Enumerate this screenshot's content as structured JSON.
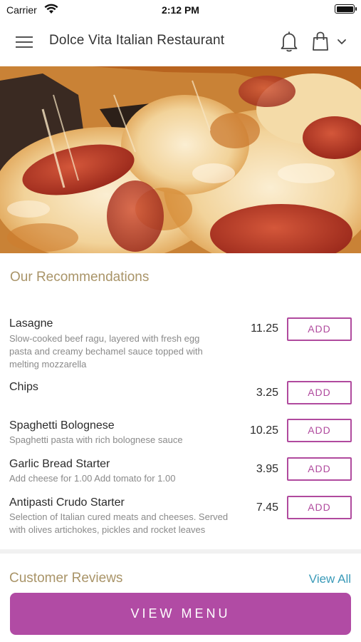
{
  "status_bar": {
    "carrier": "Carrier",
    "time": "2:12 PM",
    "icons": [
      "wifi-icon",
      "battery-icon"
    ]
  },
  "header": {
    "title": "Dolce Vita Italian Restaurant",
    "icons": [
      "hamburger-menu-icon",
      "bell-icon",
      "shopping-bag-icon",
      "chevron-down-icon"
    ]
  },
  "hero": {
    "image": "pepperoni-pizza-photo"
  },
  "recommendations": {
    "title": "Our Recommendations",
    "add_label": "ADD",
    "items": [
      {
        "name": "Lasagne",
        "description_lines": [
          "Slow-cooked beef ragu, layered with fresh egg",
          "pasta and creamy bechamel sauce topped with",
          "melting mozzarella"
        ],
        "price": "11.25"
      },
      {
        "name": "Chips",
        "description_lines": [],
        "price": "3.25"
      },
      {
        "name": "Spaghetti Bolognese",
        "description_lines": [
          "Spaghetti pasta with rich bolognese sauce"
        ],
        "price": "10.25"
      },
      {
        "name": "Garlic Bread Starter",
        "description_lines": [
          "Add cheese for 1.00  Add tomato for 1.00"
        ],
        "price": "3.95"
      },
      {
        "name": "Antipasti Crudo Starter",
        "description_lines": [
          "Selection of Italian cured meats and cheeses. Served",
          "with olives artichokes, pickles and rocket leaves"
        ],
        "price": "7.45"
      }
    ]
  },
  "reviews": {
    "title": "Customer Reviews",
    "view_all": "View All"
  },
  "footer": {
    "view_menu": "VIEW MENU"
  },
  "colors": {
    "accent": "#b14ba4",
    "section_title": "#a99468",
    "link": "#3a9ab8"
  }
}
